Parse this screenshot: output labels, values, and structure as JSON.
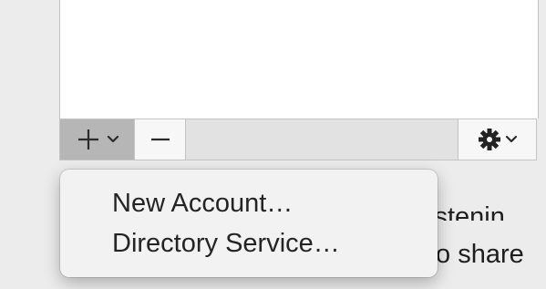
{
  "list_pane": {},
  "bottom_bar": {
    "add_button": {
      "icon": "plus-icon",
      "dropdown_icon": "chevron-down-icon"
    },
    "remove_button": {
      "icon": "minus-icon"
    },
    "action_button": {
      "icon": "gear-icon",
      "dropdown_icon": "chevron-down-icon"
    }
  },
  "add_menu": {
    "items": [
      {
        "label": "New Account…"
      },
      {
        "label": "Directory Service…"
      }
    ]
  },
  "background_text": {
    "line1": "istenin",
    "line2": "to share"
  },
  "colors": {
    "window_bg": "#ececec",
    "pressed_button": "#b6b6b6",
    "menu_bg": "#f2f2f2",
    "text": "#242424"
  }
}
